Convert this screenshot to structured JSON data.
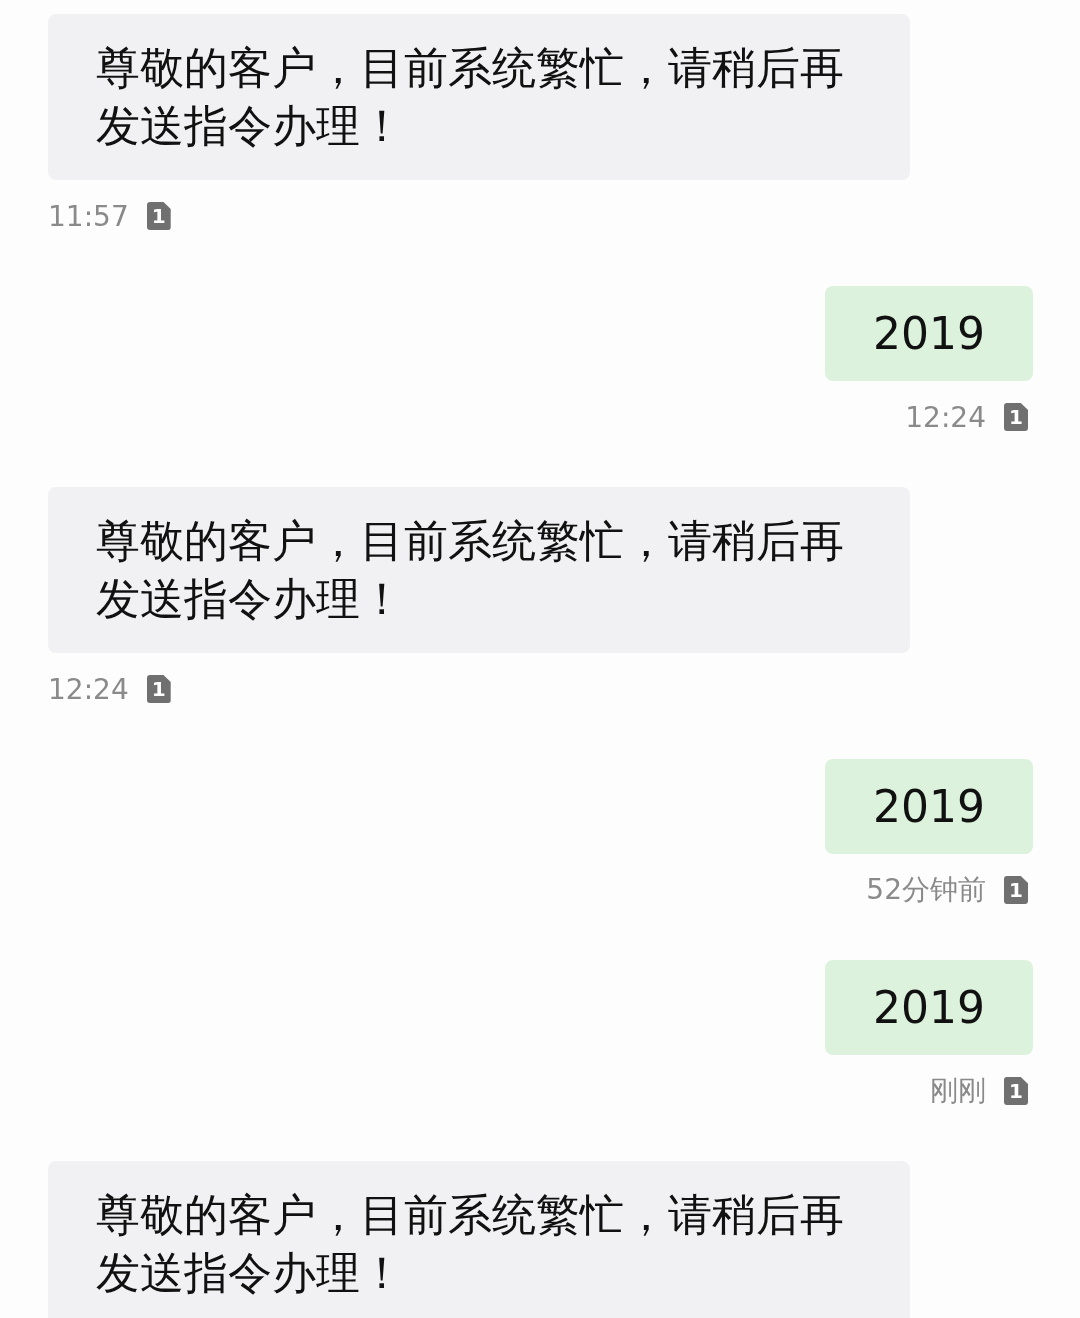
{
  "messages": [
    {
      "kind": "received",
      "text": "尊敬的客户，目前系统繁忙，请稍后再发送指令办理！",
      "time": "11:57",
      "sim": "1"
    },
    {
      "kind": "sent",
      "text": "2019",
      "time": "12:24",
      "sim": "1"
    },
    {
      "kind": "received",
      "text": "尊敬的客户，目前系统繁忙，请稍后再发送指令办理！",
      "time": "12:24",
      "sim": "1"
    },
    {
      "kind": "sent",
      "text": "2019",
      "time": "52分钟前",
      "sim": "1"
    },
    {
      "kind": "sent",
      "text": "2019",
      "time": "刚刚",
      "sim": "1"
    },
    {
      "kind": "received",
      "text": "尊敬的客户，目前系统繁忙，请稍后再发送指令办理！"
    }
  ]
}
